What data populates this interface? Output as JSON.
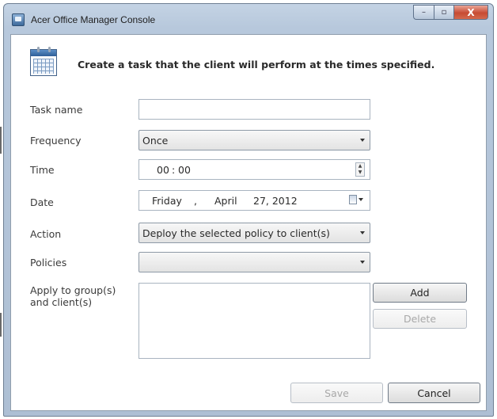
{
  "window": {
    "title": "Acer Office Manager Console",
    "controls": {
      "minimize": "–",
      "maximize": "▫",
      "close": "X"
    }
  },
  "header": {
    "headline": "Create a task that the client will perform at the times specified."
  },
  "form": {
    "task_name": {
      "label": "Task name",
      "value": ""
    },
    "frequency": {
      "label": "Frequency",
      "value": "Once"
    },
    "time": {
      "label": "Time",
      "hour": "00",
      "separator": ":",
      "minute": "00"
    },
    "date": {
      "label": "Date",
      "weekday": "Friday",
      "comma": ",",
      "month": "April",
      "day_year": "27, 2012"
    },
    "action": {
      "label": "Action",
      "value": "Deploy the selected policy to client(s)"
    },
    "policies": {
      "label": "Policies",
      "value": ""
    },
    "groups": {
      "label_line1": "Apply to group(s)",
      "label_line2": "and client(s)"
    }
  },
  "buttons": {
    "add": "Add",
    "delete": "Delete",
    "save": "Save",
    "cancel": "Cancel"
  }
}
